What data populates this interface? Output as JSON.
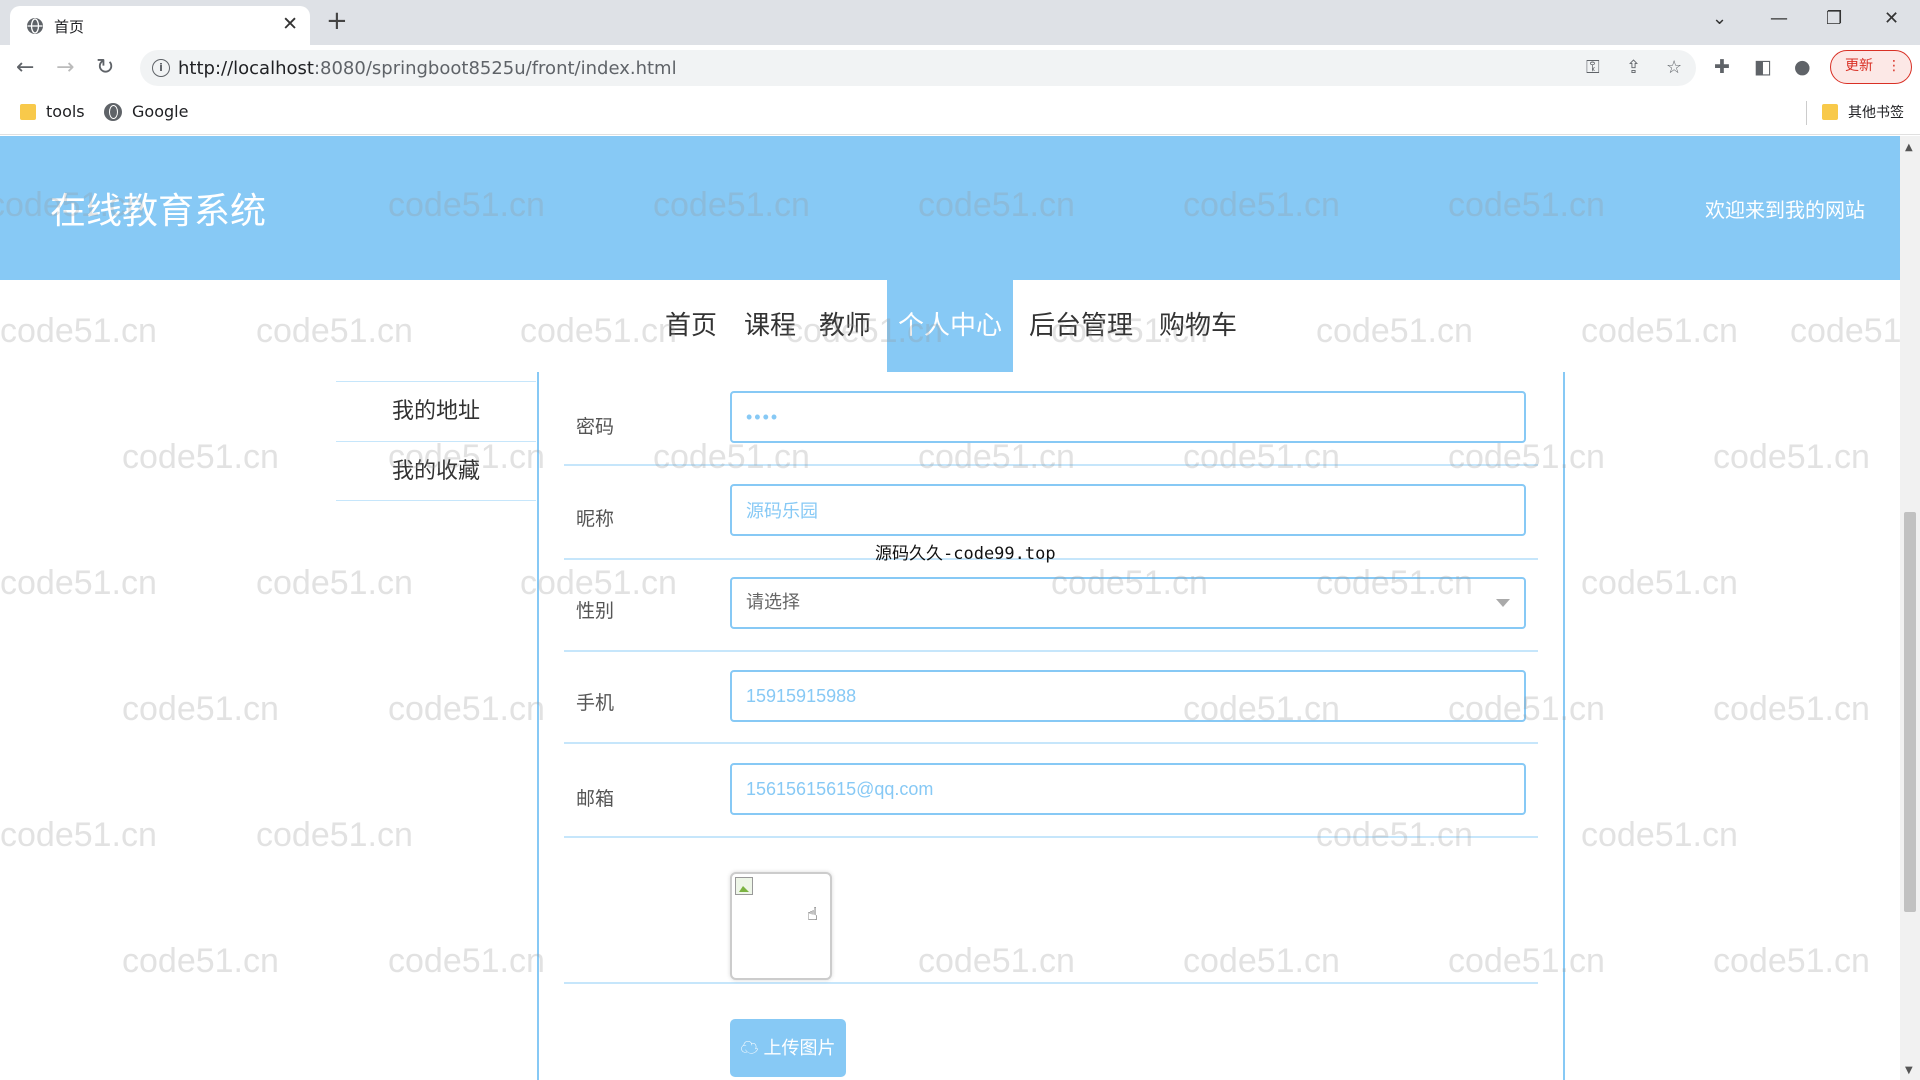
{
  "browser": {
    "tab_title": "首页",
    "tab_close": "✕",
    "new_tab": "+",
    "url_host": "http://localhost",
    "url_rest": ":8080/springboot8525u/front/index.html",
    "update_label": "更新",
    "bookmarks": [
      {
        "label": "tools",
        "icon": "folder-icon"
      },
      {
        "label": "Google",
        "icon": "globe-icon"
      }
    ],
    "other_bookmarks": "其他书签"
  },
  "site": {
    "title": "在线教育系统",
    "welcome": "欢迎来到我的网站"
  },
  "nav": {
    "items": [
      {
        "label": "首页"
      },
      {
        "label": "课程"
      },
      {
        "label": "教师"
      },
      {
        "label": "个人中心",
        "active": true
      },
      {
        "label": "后台管理"
      },
      {
        "label": "购物车"
      }
    ]
  },
  "side_menu": {
    "items": [
      {
        "label": "我的地址"
      },
      {
        "label": "我的收藏"
      }
    ]
  },
  "form": {
    "password_label": "密码",
    "password_value": "••••",
    "nickname_label": "昵称",
    "nickname_value": "源码乐园",
    "gender_label": "性别",
    "gender_placeholder": "请选择",
    "phone_label": "手机",
    "phone_value": "15915915988",
    "email_label": "邮箱",
    "email_value": "15615615615@qq.com",
    "upload_label": "上传图片"
  },
  "overlay_text": "源码久久-code99.top",
  "watermark": "code51.cn",
  "colors": {
    "primary": "#87c9f5",
    "border_light": "#c6e6fb",
    "update_red": "#d93025"
  }
}
